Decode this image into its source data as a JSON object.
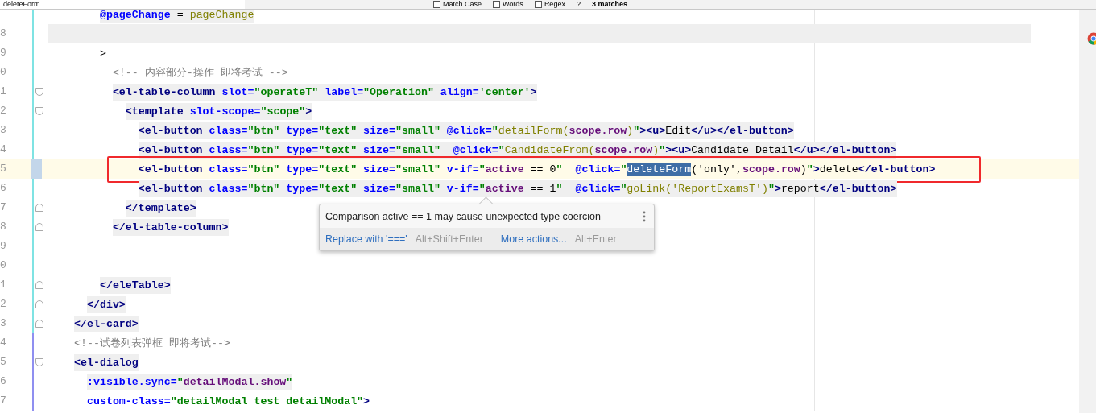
{
  "search_bar": {
    "query": "deleteForm",
    "options": [
      {
        "label": "Match Case",
        "checked": false
      },
      {
        "label": "Words",
        "checked": false
      },
      {
        "label": "Regex",
        "checked": false
      }
    ],
    "help": "?",
    "result": "3 matches"
  },
  "lines": [
    {
      "fold_start": false,
      "fold_end": false,
      "current": false,
      "boxed": false,
      "shaded": true,
      "tokens": [
        {
          "kind": "attr",
          "text": "    @pageChange"
        },
        {
          "kind": "plain",
          "text": " = "
        },
        {
          "kind": "fn",
          "text": "pageChange"
        }
      ]
    },
    {
      "number": "8",
      "fold_start": false,
      "fold_end": false,
      "current": false,
      "boxed": false,
      "shaded": true
    },
    {
      "number": "9",
      "fold_start": false,
      "fold_end": false,
      "current": false,
      "boxed": false,
      "shaded": false,
      "tokens": [
        {
          "kind": "plain",
          "text": "    >"
        }
      ]
    },
    {
      "number": "0",
      "fold_start": false,
      "fold_end": false,
      "current": false,
      "boxed": false,
      "shaded": false,
      "tokens": [
        {
          "kind": "comment",
          "text": "      <!-- 内容部分-操作 即将考试 -->"
        }
      ]
    },
    {
      "number": "1",
      "fold_start": true,
      "fold_end": false,
      "current": false,
      "boxed": false,
      "shaded": true,
      "tokens": [
        {
          "kind": "tag",
          "text": "      <el-table-column"
        },
        {
          "kind": "attr",
          "text": " slot="
        },
        {
          "kind": "str",
          "text": "\"operateT\""
        },
        {
          "kind": "attr",
          "text": " label="
        },
        {
          "kind": "str",
          "text": "\"Operation\""
        },
        {
          "kind": "attr",
          "text": " align="
        },
        {
          "kind": "str",
          "text": "'center'"
        },
        {
          "kind": "tag",
          "text": ">"
        }
      ]
    },
    {
      "number": "2",
      "fold_start": true,
      "fold_end": false,
      "current": false,
      "boxed": false,
      "shaded": true,
      "tokens": [
        {
          "kind": "tag",
          "text": "        <template"
        },
        {
          "kind": "attr",
          "text": " slot-scope="
        },
        {
          "kind": "str",
          "text": "\"scope\""
        },
        {
          "kind": "tag",
          "text": ">"
        }
      ]
    },
    {
      "number": "3",
      "fold_start": false,
      "fold_end": false,
      "current": false,
      "boxed": false,
      "shaded": true,
      "tokens": [
        {
          "kind": "tag",
          "text": "          <el-button"
        },
        {
          "kind": "attr",
          "text": " class="
        },
        {
          "kind": "str",
          "text": "\"btn\""
        },
        {
          "kind": "attr",
          "text": " type="
        },
        {
          "kind": "str",
          "text": "\"text\""
        },
        {
          "kind": "attr",
          "text": " size="
        },
        {
          "kind": "str",
          "text": "\"small\""
        },
        {
          "kind": "attr",
          "text": " @click="
        },
        {
          "kind": "str",
          "text": "\""
        },
        {
          "kind": "fn",
          "text": "detailForm("
        },
        {
          "kind": "expr",
          "text": "scope.row"
        },
        {
          "kind": "fn",
          "text": ")"
        },
        {
          "kind": "str",
          "text": "\""
        },
        {
          "kind": "tag",
          "text": "><u>"
        },
        {
          "kind": "plain",
          "text": "Edit"
        },
        {
          "kind": "tag",
          "text": "</u></el-button>"
        }
      ]
    },
    {
      "number": "4",
      "fold_start": false,
      "fold_end": false,
      "current": false,
      "boxed": false,
      "shaded": true,
      "tokens": [
        {
          "kind": "tag",
          "text": "          <el-button"
        },
        {
          "kind": "attr",
          "text": " class="
        },
        {
          "kind": "str",
          "text": "\"btn\""
        },
        {
          "kind": "attr",
          "text": " type="
        },
        {
          "kind": "str",
          "text": "\"text\""
        },
        {
          "kind": "attr",
          "text": " size="
        },
        {
          "kind": "str",
          "text": "\"small\""
        },
        {
          "kind": "attr",
          "text": "  @click="
        },
        {
          "kind": "str",
          "text": "\""
        },
        {
          "kind": "fn",
          "text": "CandidateFrom("
        },
        {
          "kind": "expr",
          "text": "scope.row"
        },
        {
          "kind": "fn",
          "text": ")"
        },
        {
          "kind": "str",
          "text": "\""
        },
        {
          "kind": "tag",
          "text": "><u>"
        },
        {
          "kind": "plain",
          "text": "Candidate Detail"
        },
        {
          "kind": "tag",
          "text": "</u></el-button>"
        }
      ]
    },
    {
      "number": "5",
      "fold_start": false,
      "fold_end": false,
      "current": true,
      "boxed": true,
      "shaded": false,
      "tokens": [
        {
          "kind": "tag",
          "text": "          <el-button"
        },
        {
          "kind": "attr",
          "text": " class="
        },
        {
          "kind": "str",
          "text": "\"btn\""
        },
        {
          "kind": "attr",
          "text": " type="
        },
        {
          "kind": "str",
          "text": "\"text\""
        },
        {
          "kind": "attr",
          "text": " size="
        },
        {
          "kind": "str",
          "text": "\"small\""
        },
        {
          "kind": "attr",
          "text": " v-if="
        },
        {
          "kind": "str",
          "text": "\""
        },
        {
          "kind": "expr",
          "text": "active"
        },
        {
          "kind": "plain",
          "text": " == 0"
        },
        {
          "kind": "str",
          "text": "\""
        },
        {
          "kind": "attr",
          "text": "  @click="
        },
        {
          "kind": "str",
          "text": "\""
        },
        {
          "kind": "match",
          "text": "deleteForm"
        },
        {
          "kind": "plain",
          "text": "('only',"
        },
        {
          "kind": "expr",
          "text": "scope.row"
        },
        {
          "kind": "plain",
          "text": ")"
        },
        {
          "kind": "str",
          "text": "\""
        },
        {
          "kind": "tag",
          "text": ">"
        },
        {
          "kind": "plain",
          "text": "delete"
        },
        {
          "kind": "tag",
          "text": "</el-button>"
        }
      ]
    },
    {
      "number": "6",
      "fold_start": false,
      "fold_end": false,
      "current": false,
      "boxed": false,
      "shaded": true,
      "tokens": [
        {
          "kind": "tag",
          "text": "          <el-button"
        },
        {
          "kind": "attr",
          "text": " class="
        },
        {
          "kind": "str",
          "text": "\"btn\""
        },
        {
          "kind": "attr",
          "text": " type="
        },
        {
          "kind": "str",
          "text": "\"text\""
        },
        {
          "kind": "attr",
          "text": " size="
        },
        {
          "kind": "str",
          "text": "\"small\""
        },
        {
          "kind": "attr",
          "text": " v-if="
        },
        {
          "kind": "str",
          "text": "\""
        },
        {
          "kind": "expr",
          "text": "active"
        },
        {
          "kind": "plain",
          "text": " == 1"
        },
        {
          "kind": "str",
          "text": "\""
        },
        {
          "kind": "attr",
          "text": "  @click="
        },
        {
          "kind": "str",
          "text": "\""
        },
        {
          "kind": "fn",
          "text": "goLink('ReportExamsT')"
        },
        {
          "kind": "str",
          "text": "\""
        },
        {
          "kind": "tag",
          "text": ">"
        },
        {
          "kind": "plain",
          "text": "report"
        },
        {
          "kind": "tag",
          "text": "</el-button>"
        }
      ]
    },
    {
      "number": "7",
      "fold_start": false,
      "fold_end": true,
      "current": false,
      "boxed": false,
      "shaded": true,
      "tokens": [
        {
          "kind": "tag",
          "text": "        </template>"
        }
      ]
    },
    {
      "number": "8",
      "fold_start": false,
      "fold_end": true,
      "current": false,
      "boxed": false,
      "shaded": true,
      "tokens": [
        {
          "kind": "tag",
          "text": "      </el-table-column>"
        }
      ]
    },
    {
      "number": "9",
      "fold_start": false,
      "fold_end": false,
      "current": false,
      "boxed": false,
      "shaded": false
    },
    {
      "number": "0",
      "fold_start": false,
      "fold_end": false,
      "current": false,
      "boxed": false,
      "shaded": false
    },
    {
      "number": "1",
      "fold_start": false,
      "fold_end": true,
      "current": false,
      "boxed": false,
      "shaded": true,
      "tokens": [
        {
          "kind": "tag",
          "text": "    </eleTable>"
        }
      ]
    },
    {
      "number": "2",
      "fold_start": false,
      "fold_end": true,
      "current": false,
      "boxed": false,
      "shaded": true,
      "tokens": [
        {
          "kind": "tag",
          "text": "  </div>"
        }
      ]
    },
    {
      "number": "3",
      "fold_start": false,
      "fold_end": true,
      "current": false,
      "boxed": false,
      "shaded": true,
      "tokens": [
        {
          "kind": "tag",
          "text": "</el-card>"
        }
      ]
    },
    {
      "number": "4",
      "fold_start": false,
      "fold_end": false,
      "current": false,
      "boxed": false,
      "shaded": false,
      "tokens": [
        {
          "kind": "comment",
          "text": "<!--试卷列表弹框 即将考试-->"
        }
      ]
    },
    {
      "number": "5",
      "fold_start": true,
      "fold_end": false,
      "current": false,
      "boxed": false,
      "shaded": true,
      "tokens": [
        {
          "kind": "tag",
          "text": "<el-dialog"
        }
      ]
    },
    {
      "number": "6",
      "fold_start": false,
      "fold_end": false,
      "current": false,
      "boxed": false,
      "shaded": true,
      "tokens": [
        {
          "kind": "attr",
          "text": "  :visible.sync="
        },
        {
          "kind": "str",
          "text": "\""
        },
        {
          "kind": "expr",
          "text": "detailModal.show"
        },
        {
          "kind": "str",
          "text": "\""
        }
      ]
    },
    {
      "number": "7",
      "fold_start": false,
      "fold_end": false,
      "current": false,
      "boxed": false,
      "shaded": false,
      "tokens": [
        {
          "kind": "attr",
          "text": "  custom-class="
        },
        {
          "kind": "str",
          "text": "\"detailModal test detailModal\""
        },
        {
          "kind": "tag",
          "text": ">"
        }
      ]
    }
  ],
  "tooltip": {
    "message": "Comparison active == 1 may cause unexpected type coercion",
    "actions": [
      {
        "label": "Replace with '==='",
        "shortcut": "Alt+Shift+Enter"
      },
      {
        "label": "More actions...",
        "shortcut": "Alt+Enter"
      }
    ]
  }
}
